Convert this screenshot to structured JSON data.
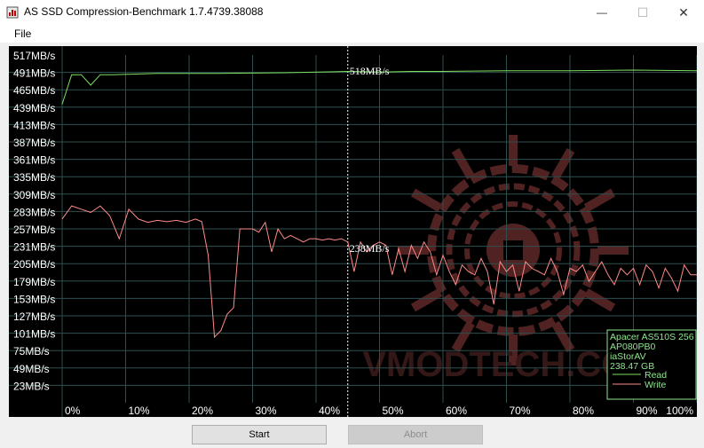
{
  "window": {
    "title": "AS SSD Compression-Benchmark 1.7.4739.38088",
    "minimize_glyph": "—",
    "maximize_glyph": "☐",
    "close_glyph": "✕"
  },
  "menu": {
    "file_label": "File"
  },
  "buttons": {
    "start_label": "Start",
    "abort_label": "Abort"
  },
  "info_panel": {
    "lines": [
      "Apacer AS510S 256",
      "AP080PB0",
      "iaStorAV",
      "238.47 GB"
    ],
    "legend_read": "Read",
    "legend_write": "Write"
  },
  "colors": {
    "plot_bg": "#000000",
    "grid": "#2f4f4f",
    "axis_text": "#ffffff",
    "read": "#80e060",
    "write": "#ff8a8a",
    "info_text": "#8ee88e",
    "marker": "#ffffff",
    "watermark": "#5a2626"
  },
  "watermark_text": "VMODTECH.COM",
  "chart_data": {
    "type": "line",
    "yticks": [
      "517MB/s",
      "491MB/s",
      "465MB/s",
      "439MB/s",
      "413MB/s",
      "387MB/s",
      "361MB/s",
      "335MB/s",
      "309MB/s",
      "283MB/s",
      "257MB/s",
      "231MB/s",
      "205MB/s",
      "179MB/s",
      "153MB/s",
      "127MB/s",
      "101MB/s",
      "75MB/s",
      "49MB/s",
      "23MB/s"
    ],
    "xticks": [
      "0%",
      "10%",
      "20%",
      "30%",
      "40%",
      "50%",
      "60%",
      "70%",
      "80%",
      "90%",
      "100%"
    ],
    "ylim": [
      0,
      530
    ],
    "xlim": [
      0,
      100
    ],
    "marker_x": 45,
    "read_label": "518MB/s",
    "write_label": "238MB/s",
    "series": [
      {
        "name": "Read",
        "x": [
          0,
          1.5,
          3,
          4.5,
          6,
          8,
          15,
          25,
          35,
          45,
          50,
          55,
          60,
          70,
          80,
          90,
          100
        ],
        "y": [
          455,
          500,
          500,
          484,
          500,
          500,
          502,
          502,
          503,
          505,
          504,
          505,
          505,
          506,
          506,
          507,
          506
        ]
      },
      {
        "name": "Write",
        "x": [
          0,
          1.5,
          3,
          4.5,
          6,
          7.5,
          9,
          10.5,
          12,
          13.5,
          15,
          16.5,
          18,
          19.5,
          21,
          22,
          23,
          24,
          25,
          26,
          27,
          28,
          29,
          30,
          31,
          32,
          33,
          34,
          35,
          36,
          37,
          38,
          39,
          40,
          41,
          42,
          43,
          44,
          45,
          46,
          47,
          48,
          49,
          50,
          51,
          52,
          53,
          54,
          55,
          56,
          57,
          58,
          59,
          60,
          61,
          62,
          63,
          64,
          65,
          66,
          67,
          68,
          69,
          70,
          71,
          72,
          73,
          74,
          75,
          76,
          77,
          78,
          79,
          80,
          81,
          82,
          83,
          84,
          85,
          86,
          87,
          88,
          89,
          90,
          91,
          92,
          93,
          94,
          95,
          96,
          97,
          98,
          99,
          100
        ],
        "y": [
          280,
          300,
          295,
          290,
          300,
          285,
          250,
          295,
          280,
          275,
          278,
          276,
          278,
          275,
          280,
          276,
          225,
          100,
          110,
          135,
          145,
          265,
          265,
          265,
          260,
          275,
          230,
          265,
          250,
          255,
          250,
          245,
          250,
          250,
          248,
          250,
          248,
          250,
          245,
          200,
          245,
          230,
          240,
          245,
          240,
          195,
          235,
          200,
          240,
          220,
          245,
          230,
          195,
          225,
          200,
          180,
          210,
          200,
          195,
          220,
          200,
          150,
          215,
          200,
          210,
          170,
          215,
          205,
          200,
          195,
          220,
          200,
          165,
          205,
          200,
          210,
          185,
          200,
          215,
          195,
          180,
          205,
          195,
          205,
          180,
          210,
          200,
          175,
          205,
          190,
          170,
          210,
          195,
          195
        ]
      }
    ]
  }
}
